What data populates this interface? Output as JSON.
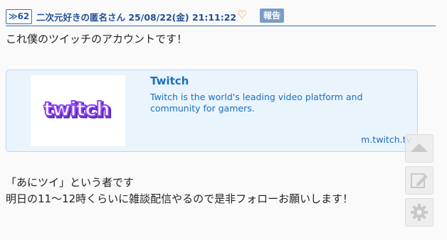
{
  "post": {
    "number": "≫62",
    "meta": "二次元好きの匿名さん 25/08/22(金) 21:11:22",
    "heart_icon": "heart-outline-icon",
    "report_label": "報告",
    "line1": "これ僕のツイッチのアカウントです！",
    "line2": "「あにツイ」という者です",
    "line3": "明日の11～12時くらいに雑談配信やるので是非フォローお願いします！"
  },
  "link_card": {
    "title": "Twitch",
    "description": "Twitch is the world's leading video platform and community for gamers.",
    "domain": "m.twitch.tv",
    "logo_text": "twitch",
    "logo_color": "#9146ff"
  },
  "side_buttons": {
    "up_icon": "arrow-up-icon",
    "edit_icon": "pencil-icon",
    "settings_icon": "gear-icon"
  },
  "colors": {
    "accent": "#1f4f96",
    "link": "#1a6fc0",
    "report_bg": "#7b9bc8",
    "heart": "#e87a2c"
  }
}
